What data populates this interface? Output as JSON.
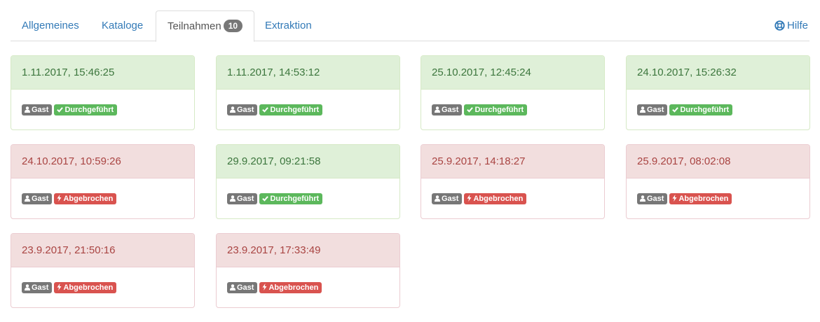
{
  "tabs": [
    {
      "label": "Allgemeines",
      "active": false
    },
    {
      "label": "Kataloge",
      "active": false
    },
    {
      "label": "Teilnahmen",
      "active": true,
      "count": "10"
    },
    {
      "label": "Extraktion",
      "active": false
    }
  ],
  "help": {
    "label": "Hilfe",
    "icon": "lifebuoy-icon"
  },
  "badges": {
    "guest": "Gast",
    "done": "Durchgeführt",
    "abort": "Abgebrochen"
  },
  "colors": {
    "link": "#337ab7",
    "success_bg": "#dff0d8",
    "success_text": "#3c763d",
    "danger_bg": "#f2dede",
    "danger_text": "#a94442",
    "label_success": "#5cb85c",
    "label_danger": "#d9534f",
    "label_default": "#777777"
  },
  "participations": [
    {
      "timestamp": "1.11.2017, 15:46:25",
      "status": "done"
    },
    {
      "timestamp": "1.11.2017, 14:53:12",
      "status": "done"
    },
    {
      "timestamp": "25.10.2017, 12:45:24",
      "status": "done"
    },
    {
      "timestamp": "24.10.2017, 15:26:32",
      "status": "done"
    },
    {
      "timestamp": "24.10.2017, 10:59:26",
      "status": "abort"
    },
    {
      "timestamp": "29.9.2017, 09:21:58",
      "status": "done"
    },
    {
      "timestamp": "25.9.2017, 14:18:27",
      "status": "abort"
    },
    {
      "timestamp": "25.9.2017, 08:02:08",
      "status": "abort"
    },
    {
      "timestamp": "23.9.2017, 21:50:16",
      "status": "abort"
    },
    {
      "timestamp": "23.9.2017, 17:33:49",
      "status": "abort"
    }
  ]
}
